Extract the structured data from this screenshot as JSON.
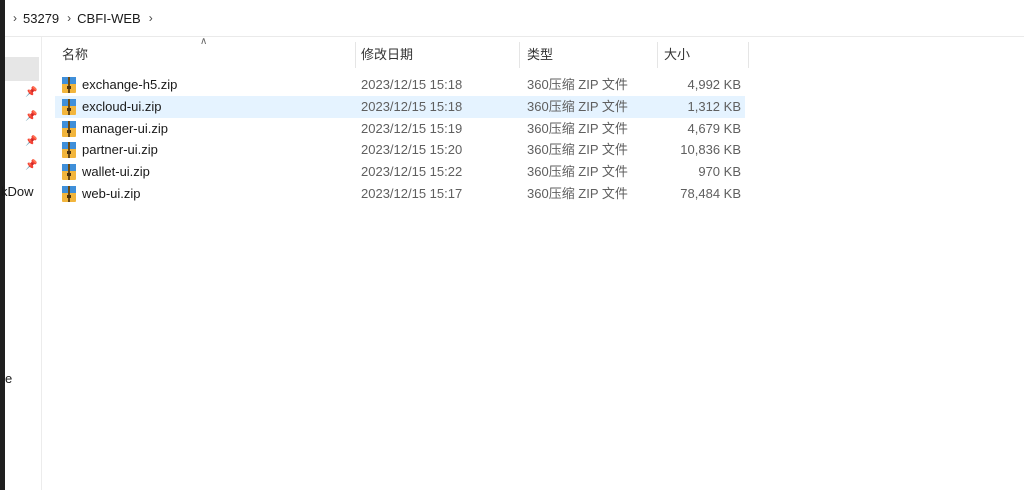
{
  "breadcrumb": {
    "items": [
      "53279",
      "CBFI-WEB"
    ]
  },
  "nav": {
    "partial_labels": [
      "kDow",
      "e"
    ]
  },
  "columns": {
    "name": "名称",
    "date": "修改日期",
    "type": "类型",
    "size": "大小"
  },
  "files": [
    {
      "name": "exchange-h5.zip",
      "date": "2023/12/15 15:18",
      "type": "360压缩 ZIP 文件",
      "size": "4,992 KB",
      "selected": false
    },
    {
      "name": "excloud-ui.zip",
      "date": "2023/12/15 15:18",
      "type": "360压缩 ZIP 文件",
      "size": "1,312 KB",
      "selected": true
    },
    {
      "name": "manager-ui.zip",
      "date": "2023/12/15 15:19",
      "type": "360压缩 ZIP 文件",
      "size": "4,679 KB",
      "selected": false
    },
    {
      "name": "partner-ui.zip",
      "date": "2023/12/15 15:20",
      "type": "360压缩 ZIP 文件",
      "size": "10,836 KB",
      "selected": false
    },
    {
      "name": "wallet-ui.zip",
      "date": "2023/12/15 15:22",
      "type": "360压缩 ZIP 文件",
      "size": "970 KB",
      "selected": false
    },
    {
      "name": "web-ui.zip",
      "date": "2023/12/15 15:17",
      "type": "360压缩 ZIP 文件",
      "size": "78,484 KB",
      "selected": false
    }
  ],
  "icons": {
    "file": "zip-archive-icon",
    "pin": "pin-icon",
    "chevron": "chevron-right-icon",
    "sort": "sort-ascending-icon"
  }
}
